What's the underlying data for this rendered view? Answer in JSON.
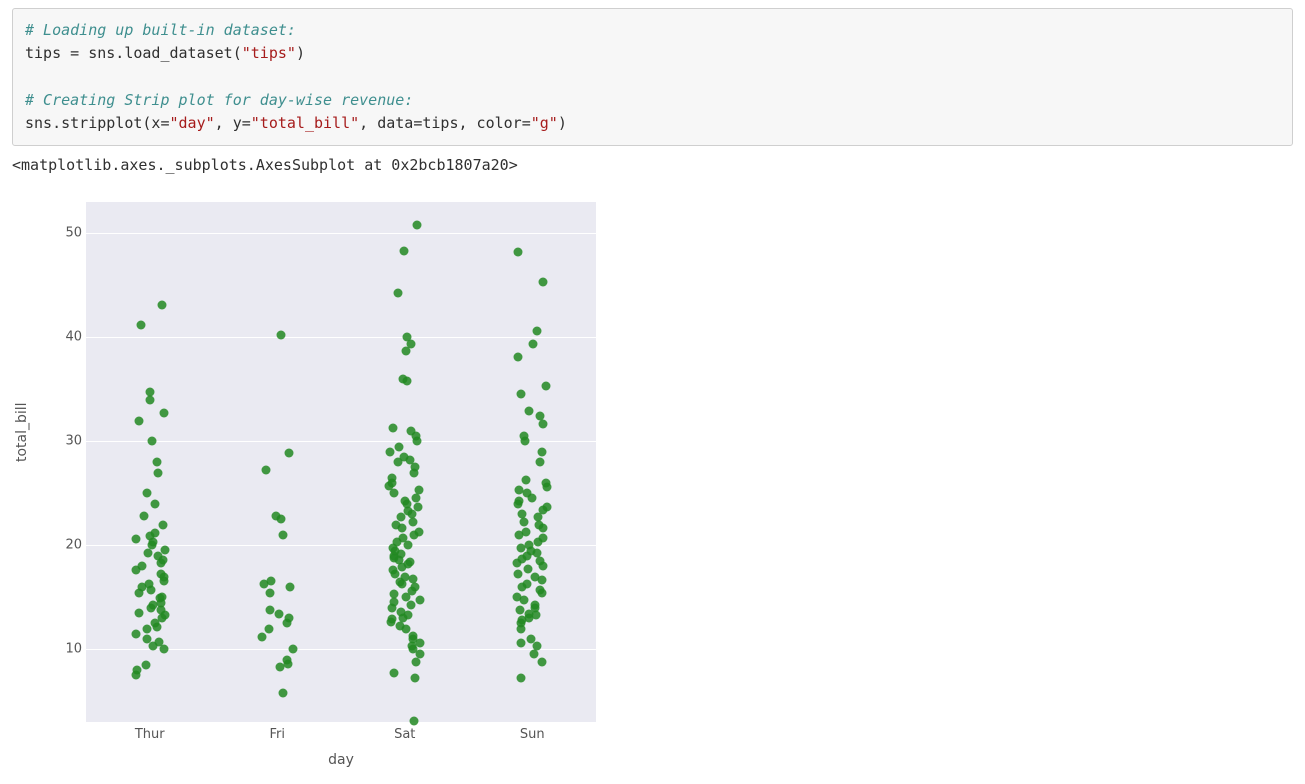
{
  "code": {
    "line1_comment": "# Loading up built-in dataset:",
    "line2_a": "tips = sns.load_dataset(",
    "line2_b": "\"tips\"",
    "line2_c": ")",
    "blank": "",
    "line3_comment": "# Creating Strip plot for day-wise revenue:",
    "line4_a": "sns.stripplot(x=",
    "line4_b": "\"day\"",
    "line4_c": ", y=",
    "line4_d": "\"total_bill\"",
    "line4_e": ", data=tips, color=",
    "line4_f": "\"g\"",
    "line4_g": ")"
  },
  "output_text": "<matplotlib.axes._subplots.AxesSubplot at 0x2bcb1807a20>",
  "chart_data": {
    "type": "strip",
    "xlabel": "day",
    "ylabel": "total_bill",
    "categories": [
      "Thur",
      "Fri",
      "Sat",
      "Sun"
    ],
    "ylim": [
      3,
      53
    ],
    "yticks": [
      10,
      20,
      30,
      40,
      50
    ],
    "point_color": "#228822",
    "series": [
      {
        "name": "Thur",
        "values": [
          7.5,
          8.0,
          8.5,
          10.0,
          10.3,
          10.7,
          11.0,
          11.5,
          12.0,
          12.2,
          12.5,
          13.0,
          13.3,
          13.5,
          13.8,
          14.0,
          14.3,
          14.5,
          14.9,
          15.0,
          15.4,
          15.7,
          16.0,
          16.3,
          16.6,
          17.0,
          17.3,
          17.6,
          18.0,
          18.3,
          18.6,
          19.0,
          19.3,
          19.6,
          20.0,
          20.3,
          20.6,
          20.9,
          21.2,
          22.0,
          22.8,
          24.0,
          25.0,
          27.0,
          28.0,
          30.0,
          32.0,
          32.7,
          34.0,
          34.8,
          41.2,
          43.1
        ]
      },
      {
        "name": "Fri",
        "values": [
          5.8,
          8.3,
          8.6,
          9.0,
          10.0,
          11.2,
          12.0,
          12.5,
          13.0,
          13.4,
          13.8,
          15.4,
          16.0,
          16.3,
          16.6,
          21.0,
          22.5,
          22.8,
          27.3,
          28.9,
          40.2
        ]
      },
      {
        "name": "Sat",
        "values": [
          3.1,
          7.3,
          7.7,
          8.8,
          9.6,
          10.0,
          10.3,
          10.6,
          11.0,
          11.3,
          12.0,
          12.3,
          12.6,
          12.9,
          13.0,
          13.3,
          13.6,
          14.0,
          14.3,
          14.6,
          14.8,
          15.0,
          15.3,
          15.6,
          16.0,
          16.3,
          16.5,
          16.8,
          17.0,
          17.3,
          17.6,
          17.9,
          18.2,
          18.4,
          18.6,
          18.8,
          19.0,
          19.2,
          19.5,
          19.8,
          20.0,
          20.3,
          20.7,
          21.0,
          21.3,
          21.7,
          22.0,
          22.3,
          22.7,
          23.0,
          23.3,
          23.7,
          24.0,
          24.3,
          24.6,
          25.0,
          25.3,
          25.7,
          26.0,
          26.5,
          27.0,
          27.5,
          28.0,
          28.2,
          28.5,
          29.0,
          29.5,
          30.0,
          30.5,
          31.0,
          31.3,
          35.8,
          36.0,
          38.7,
          39.4,
          40.0,
          44.3,
          48.3,
          50.8
        ]
      },
      {
        "name": "Sun",
        "values": [
          7.3,
          8.8,
          9.6,
          10.3,
          10.6,
          11.0,
          12.0,
          12.5,
          12.8,
          13.0,
          13.3,
          13.4,
          13.8,
          14.0,
          14.3,
          14.8,
          15.0,
          15.4,
          15.7,
          16.0,
          16.3,
          16.7,
          17.0,
          17.3,
          17.7,
          18.0,
          18.3,
          18.5,
          18.7,
          19.0,
          19.3,
          19.5,
          19.8,
          20.0,
          20.3,
          20.7,
          21.0,
          21.3,
          21.7,
          22.0,
          22.3,
          22.7,
          23.0,
          23.4,
          23.7,
          24.0,
          24.3,
          24.6,
          25.0,
          25.3,
          25.6,
          26.0,
          26.3,
          28.0,
          29.0,
          30.0,
          30.5,
          31.7,
          32.4,
          32.9,
          34.6,
          35.3,
          38.1,
          39.4,
          40.6,
          45.3,
          48.2
        ]
      }
    ]
  }
}
